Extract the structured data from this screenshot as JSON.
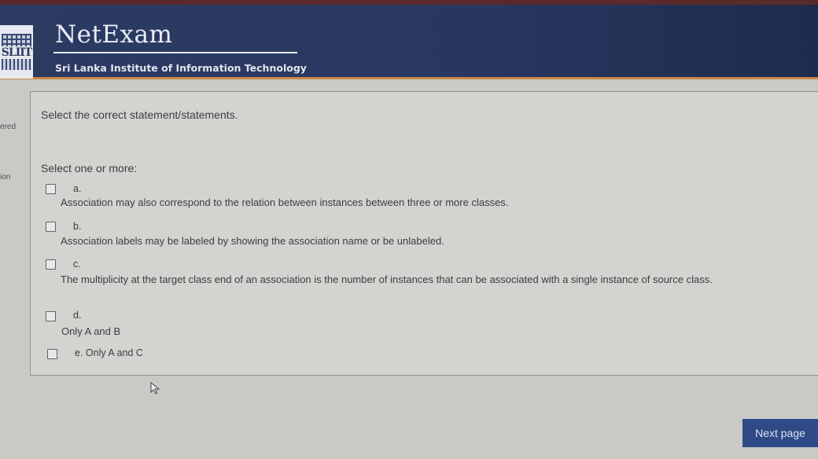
{
  "header": {
    "logo_text": "SLIIT",
    "brand": "NetExam",
    "subtitle": "Sri Lanka Institute of Information Technology"
  },
  "sidebar": {
    "label1": "ered",
    "label2": "ion"
  },
  "question": {
    "text": "Select the correct statement/statements.",
    "prompt": "Select one or more:",
    "options": [
      {
        "letter": "a.",
        "text": "Association may also correspond to the relation between instances between three or more classes."
      },
      {
        "letter": "b.",
        "text": "Association labels may be labeled by showing the association name or be unlabeled."
      },
      {
        "letter": "c.",
        "text": "The multiplicity at the target class end of an association is the number of instances that can be associated with a single instance of source class."
      },
      {
        "letter": "d.",
        "text": "Only A and B"
      },
      {
        "letter": "e. Only A and C",
        "text": ""
      }
    ]
  },
  "footer": {
    "next_label": "Next page"
  },
  "icons": {
    "cursor": "mouse-pointer-icon",
    "checkbox": "checkbox-icon"
  }
}
